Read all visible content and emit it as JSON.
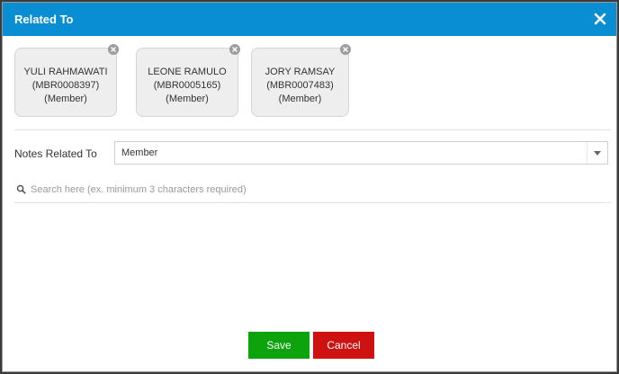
{
  "dialog": {
    "title": "Related To",
    "close_icon": "close-icon"
  },
  "related_members": [
    {
      "name": "YULI RAHMAWATI",
      "id": "(MBR0008397)",
      "type": "(Member)"
    },
    {
      "name": "LEONE RAMULO",
      "id": "(MBR0005165)",
      "type": "(Member)"
    },
    {
      "name": "JORY RAMSAY",
      "id": "(MBR0007483)",
      "type": "(Member)"
    }
  ],
  "notes_related_to": {
    "label": "Notes Related To",
    "selected": "Member"
  },
  "search": {
    "placeholder": "Search here (ex. minimum 3 characters required)",
    "value": ""
  },
  "actions": {
    "save_label": "Save",
    "cancel_label": "Cancel"
  },
  "colors": {
    "header": "#0a8ed3",
    "save": "#0ca30c",
    "cancel": "#cf1111"
  }
}
